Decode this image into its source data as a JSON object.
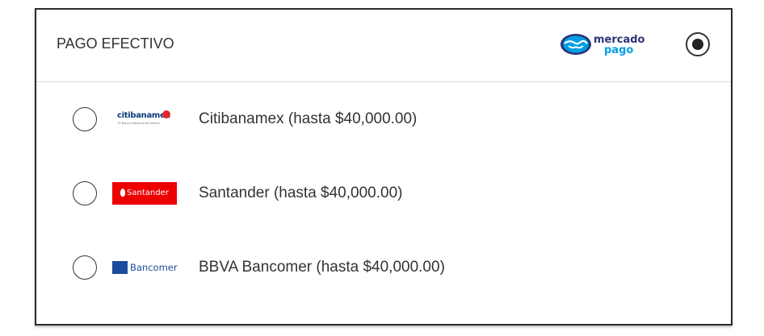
{
  "panel": {
    "title": "PAGO EFECTIVO",
    "provider_logo": {
      "icon": "mercadopago-handshake-icon",
      "word1": "mercado",
      "word2": "pago",
      "colors": {
        "primary": "#2d3277",
        "accent": "#009ee3"
      }
    },
    "selected": true
  },
  "options": [
    {
      "label": "Citibanamex (hasta $40,000.00)",
      "logo": {
        "name": "citibanamex-logo",
        "text": "citibanamex",
        "subtext": "El Banco Nacional de México",
        "color": "#0a3a7a"
      },
      "selected": false
    },
    {
      "label": "Santander (hasta $40,000.00)",
      "logo": {
        "name": "santander-logo",
        "text": "Santander",
        "color": "#ec0000"
      },
      "selected": false
    },
    {
      "label": "BBVA Bancomer (hasta $40,000.00)",
      "logo": {
        "name": "bancomer-logo",
        "text": "Bancomer",
        "color": "#1c4c9c"
      },
      "selected": false
    }
  ]
}
